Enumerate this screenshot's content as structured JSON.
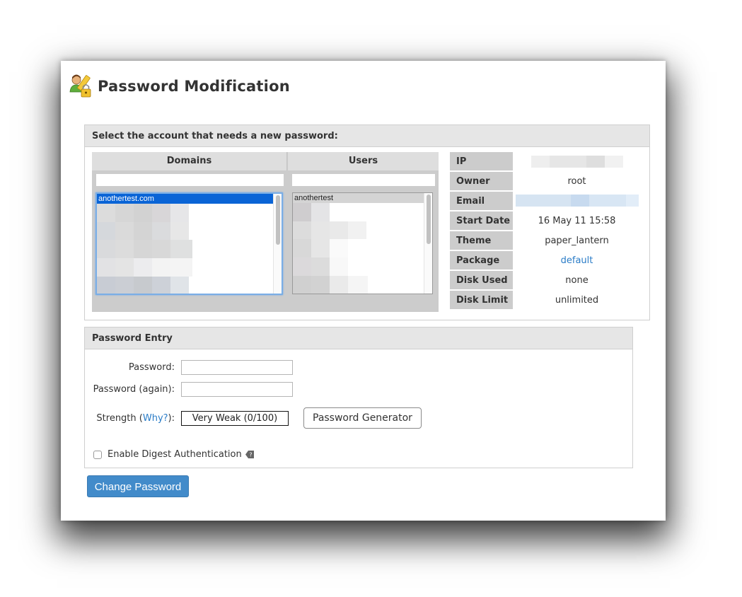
{
  "page": {
    "title": "Password Modification",
    "title_icon": "user-pencil-lock-icon"
  },
  "account_panel": {
    "heading": "Select the account that needs a new password:",
    "domains": {
      "header": "Domains",
      "filter_value": "",
      "selected": "anothertest.com",
      "other_items_obscured": true
    },
    "users": {
      "header": "Users",
      "filter_value": "",
      "selected": "anothertest",
      "other_items_obscured": true
    },
    "info": [
      {
        "label": "IP",
        "value": "",
        "obscured": true
      },
      {
        "label": "Owner",
        "value": "root"
      },
      {
        "label": "Email",
        "value": "",
        "obscured": true
      },
      {
        "label": "Start Date",
        "value": "16 May 11 15:58"
      },
      {
        "label": "Theme",
        "value": "paper_lantern"
      },
      {
        "label": "Package",
        "value": "default",
        "link": true
      },
      {
        "label": "Disk Used",
        "value": "none"
      },
      {
        "label": "Disk Limit",
        "value": "unlimited"
      }
    ]
  },
  "password_panel": {
    "heading": "Password Entry",
    "password_label": "Password:",
    "password_value": "",
    "password_again_label": "Password (again):",
    "password_again_value": "",
    "strength_label_prefix": "Strength (",
    "strength_why": "Why?",
    "strength_label_suffix": "):",
    "strength_value": "Very Weak (0/100)",
    "strength_score": 0,
    "generator_button": "Password Generator",
    "digest_label": "Enable Digest Authentication",
    "digest_checked": false
  },
  "actions": {
    "submit": "Change Password"
  },
  "colors": {
    "accent": "#428bca",
    "link": "#2a7cc7",
    "selection": "#0a64d6"
  }
}
